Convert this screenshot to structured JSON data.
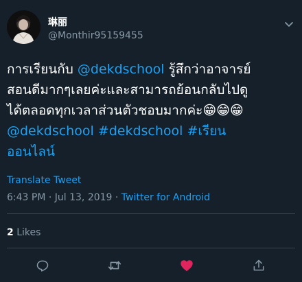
{
  "user": {
    "display_name": "琳丽",
    "handle": "@Monthir95159455"
  },
  "tweet": {
    "lines": [
      [
        {
          "type": "text",
          "value": "การเรียนกับ "
        },
        {
          "type": "mention",
          "value": "@dekdschool"
        },
        {
          "type": "text",
          "value": " รู้สึกว่าอาจารย์"
        }
      ],
      [
        {
          "type": "text",
          "value": "สอนดีมากๆเลยค่ะและสามารถย้อนกลับไปดู"
        }
      ],
      [
        {
          "type": "text",
          "value": "ได้ตลอดทุกเวลาส่วนตัวชอบมากค่ะ"
        },
        {
          "type": "emoji",
          "value": "😁😁😁"
        }
      ],
      [
        {
          "type": "mention",
          "value": "@dekdschool"
        },
        {
          "type": "text",
          "value": " "
        },
        {
          "type": "hashtag",
          "value": "#dekdschool"
        },
        {
          "type": "text",
          "value": " "
        },
        {
          "type": "hashtag",
          "value": "#เรียน"
        }
      ],
      [
        {
          "type": "hashtag",
          "value": "ออนไลน์"
        }
      ]
    ],
    "translate_label": "Translate Tweet",
    "timestamp": "6:43 PM · Jul 13, 2019 · ",
    "source": "Twitter for Android"
  },
  "stats": {
    "likes_count": "2",
    "likes_label": " Likes"
  },
  "actions": {
    "reply_icon": "reply-icon",
    "retweet_icon": "retweet-icon",
    "like_icon": "like-icon",
    "share_icon": "share-icon"
  },
  "colors": {
    "background": "#15202b",
    "accent": "#1da1f2",
    "muted": "#8899a6",
    "like": "#e0245e",
    "divider": "#38444d"
  }
}
